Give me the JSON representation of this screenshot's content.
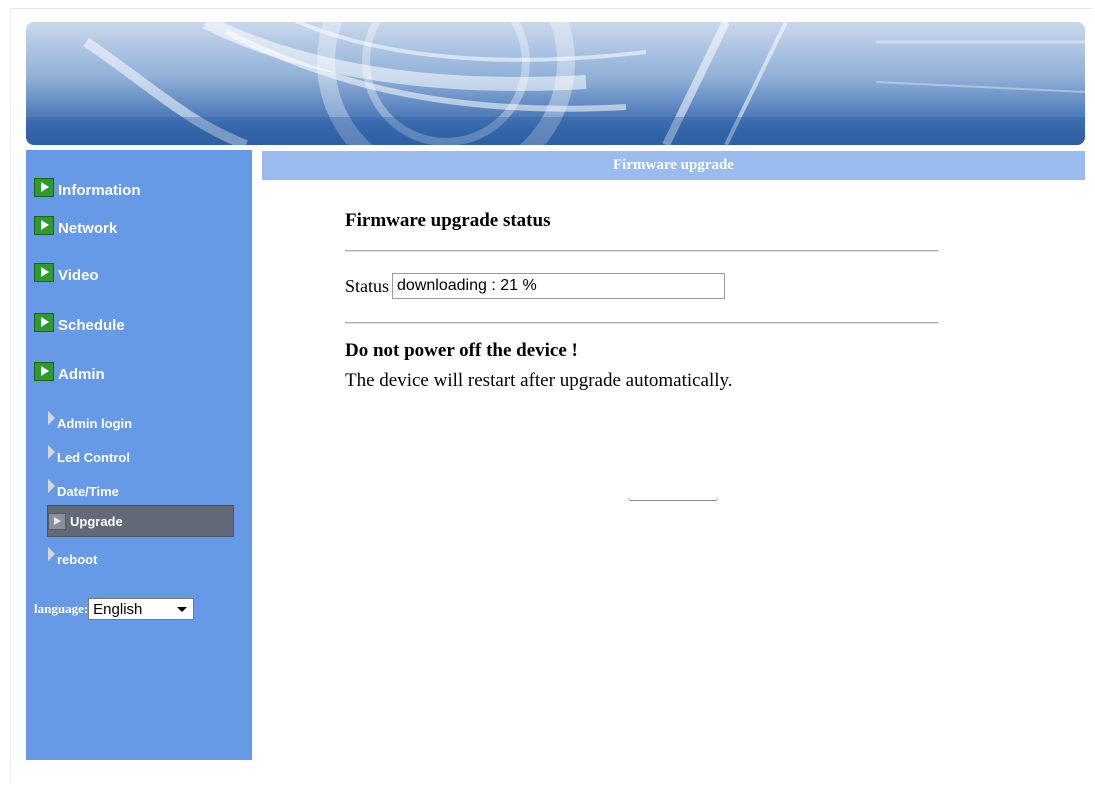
{
  "header": {
    "title": "Firmware upgrade"
  },
  "sidebar": {
    "items": [
      {
        "label": "Information"
      },
      {
        "label": "Network"
      },
      {
        "label": "Video"
      },
      {
        "label": "Schedule"
      },
      {
        "label": "Admin"
      }
    ],
    "sub_items": [
      {
        "label": "Admin login"
      },
      {
        "label": "Led Control"
      },
      {
        "label": "Date/Time"
      },
      {
        "label": "Upgrade",
        "active": true
      },
      {
        "label": "reboot"
      }
    ],
    "language": {
      "label": "language:",
      "selected": "English"
    }
  },
  "main": {
    "heading": "Firmware upgrade status",
    "status_label": "Status",
    "status_value": "downloading : 21 %",
    "warning": "Do not power off the device !",
    "note": "The device will restart after upgrade automatically."
  },
  "colors": {
    "sidebar_bg": "#6699e6",
    "titlebar_bg": "#99bbee",
    "active_item_bg": "#616a76",
    "nav_icon_green": "#2f9a2f"
  },
  "icons": {
    "main_nav": "green-arrow-box-icon",
    "sub_nav": "gray-triangle-icon",
    "dropdown": "chevron-down-icon"
  }
}
